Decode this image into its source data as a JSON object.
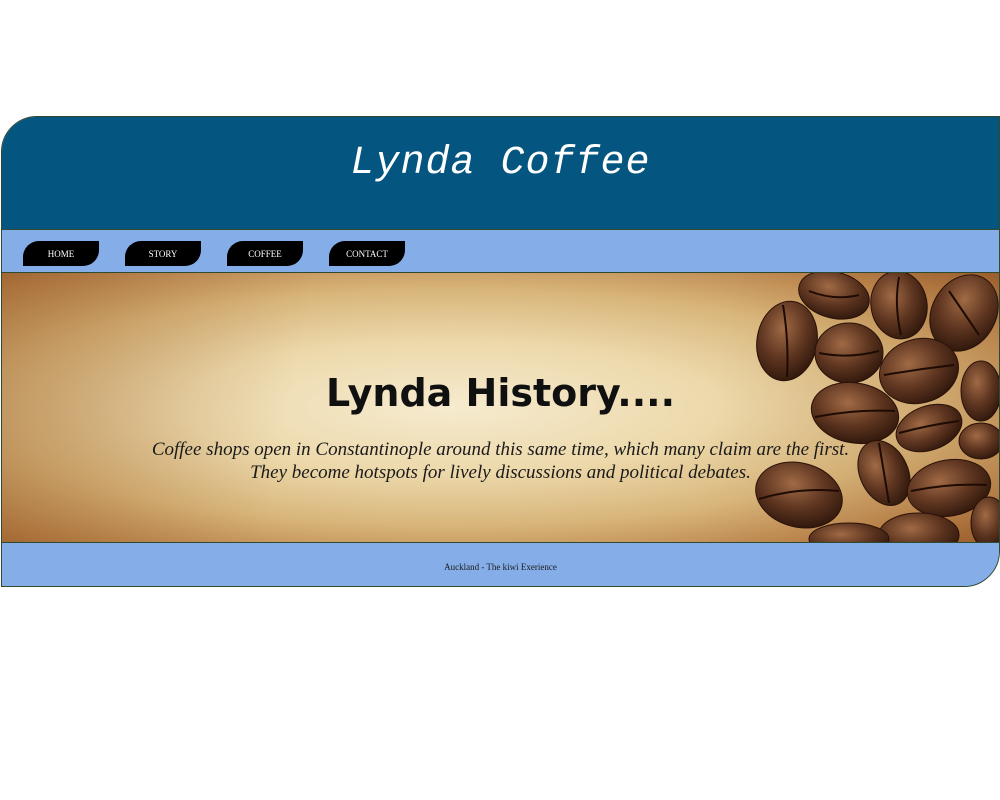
{
  "header": {
    "title": "Lynda Coffee"
  },
  "nav": {
    "items": [
      {
        "label": "HOME"
      },
      {
        "label": "STORY"
      },
      {
        "label": "COFFEE"
      },
      {
        "label": "CONTACT"
      }
    ]
  },
  "hero": {
    "heading": "Lynda History....",
    "line1": "Coffee shops open in Constantinople around this same time, which many claim are the first.",
    "line2": "They become hotspots for lively discussions and political debates.",
    "image": "coffee-beans-image"
  },
  "footer": {
    "text": "Auckland - The kiwi Exerience"
  },
  "colors": {
    "header_bg": "#04557f",
    "nav_bg": "#85aee9",
    "nav_button": "#000000",
    "hero_paper": "#ecd8aa"
  }
}
